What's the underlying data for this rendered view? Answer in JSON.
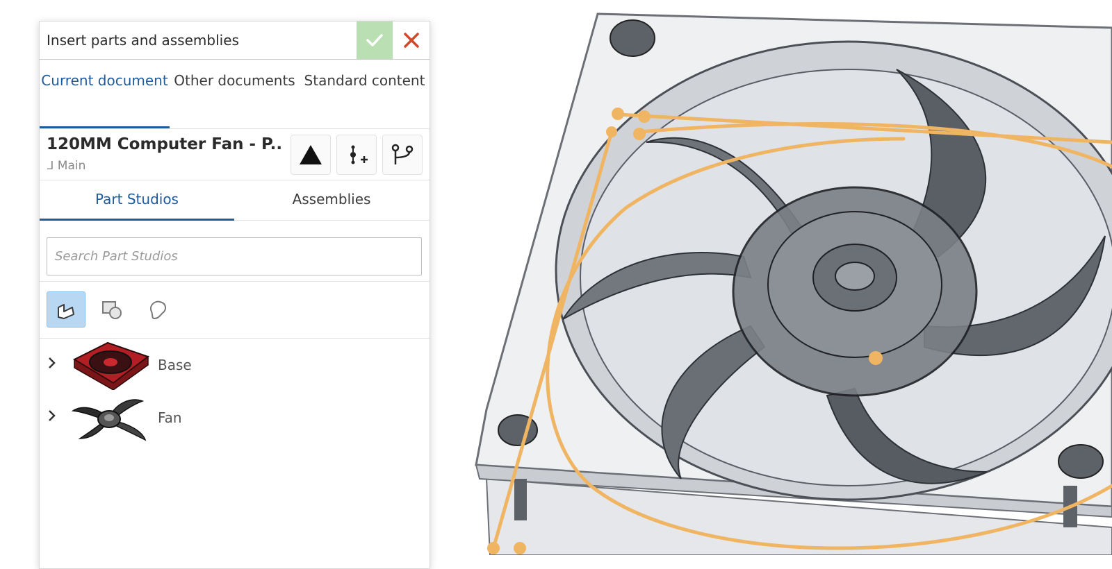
{
  "panel": {
    "title": "Insert parts and assemblies",
    "source_tabs": [
      {
        "label": "Current document",
        "active": true
      },
      {
        "label": "Other documents",
        "active": false
      },
      {
        "label": "Standard content",
        "active": false
      }
    ],
    "document": {
      "name": "120MM Computer Fan - P...",
      "branch": "Main"
    },
    "toolbar_icons": [
      "triangle-up-icon",
      "add-mate-connector-icon",
      "branch-icon"
    ],
    "studio_tabs": [
      {
        "label": "Part Studios",
        "active": true
      },
      {
        "label": "Assemblies",
        "active": false
      }
    ],
    "search": {
      "placeholder": "Search Part Studios",
      "value": ""
    },
    "filters": [
      {
        "icon": "part-filter-icon",
        "active": true
      },
      {
        "icon": "surface-filter-icon",
        "active": false
      },
      {
        "icon": "sketch-filter-icon",
        "active": false
      }
    ],
    "tree": [
      {
        "label": "Base"
      },
      {
        "label": "Fan"
      }
    ]
  },
  "colors": {
    "accent": "#1f5a9b",
    "ok": "#b9dfb3",
    "close": "#d0472a",
    "sketch": "#f0b562",
    "filter_active": "#b7d7f3"
  }
}
